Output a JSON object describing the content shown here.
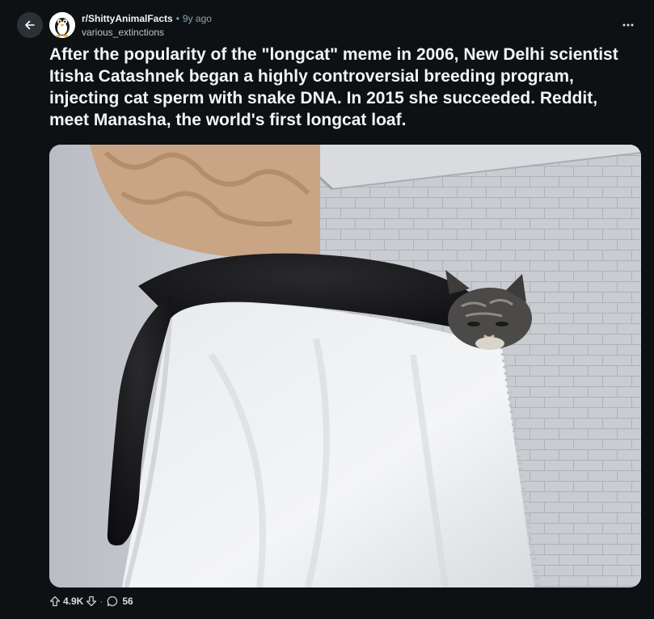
{
  "post": {
    "subreddit": "r/ShittyAnimalFacts",
    "separator": "•",
    "age": "9y ago",
    "author": "various_extinctions",
    "title": "After the popularity of the \"longcat\" meme in 2006, New Delhi scientist Itisha Catashnek began a highly controversial breeding program, injecting cat sperm with snake DNA. In 2015 she succeeded. Reddit, meet Manasha, the world's first longcat loaf.",
    "media": {
      "kind": "photo",
      "subject": "long black-and-tabby cat lying draped over a white covered box in a tiled room"
    }
  },
  "actions": {
    "upvotes": "4.9K",
    "separator": "·",
    "comments": "56"
  },
  "icons": {
    "back": "arrow-left-icon",
    "more": "more-horizontal-icon",
    "upvote": "arrow-up-icon",
    "downvote": "arrow-down-icon",
    "comment": "speech-bubble-icon",
    "subreddit_avatar": "penguin-avatar-icon"
  },
  "colors": {
    "background": "#0e1113",
    "back_button_bg": "#2a3236",
    "text_primary": "#f2f4f5",
    "text_secondary": "#8ba2ad"
  }
}
